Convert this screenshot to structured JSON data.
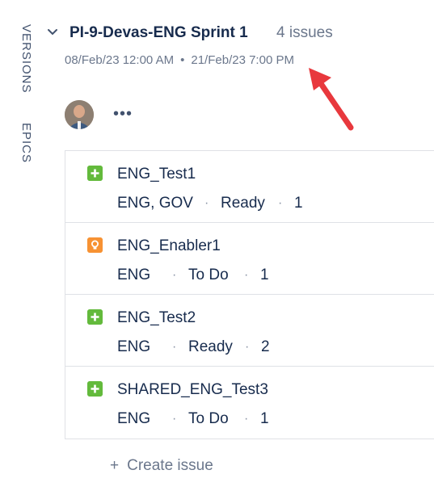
{
  "side_tabs": {
    "versions": "VERSIONS",
    "epics": "EPICS"
  },
  "sprint": {
    "title": "PI-9-Devas-ENG Sprint 1",
    "issue_count": "4 issues",
    "start": "08/Feb/23 12:00 AM",
    "separator": "•",
    "end": "21/Feb/23 7:00 PM"
  },
  "more_label": "•••",
  "issues": [
    {
      "type": "test",
      "title": "ENG_Test1",
      "components": "ENG, GOV",
      "status": "Ready",
      "points": "1"
    },
    {
      "type": "enabler",
      "title": "ENG_Enabler1",
      "components": "ENG",
      "status": "To Do",
      "points": "1"
    },
    {
      "type": "test",
      "title": "ENG_Test2",
      "components": "ENG",
      "status": "Ready",
      "points": "2"
    },
    {
      "type": "test",
      "title": "SHARED_ENG_Test3",
      "components": "ENG",
      "status": "To Do",
      "points": "1"
    }
  ],
  "meta_separator": "·",
  "create_issue": {
    "icon": "+",
    "label": "Create issue"
  },
  "colors": {
    "test": "#63ba3c",
    "enabler": "#f79233",
    "arrow": "#e8383d"
  }
}
